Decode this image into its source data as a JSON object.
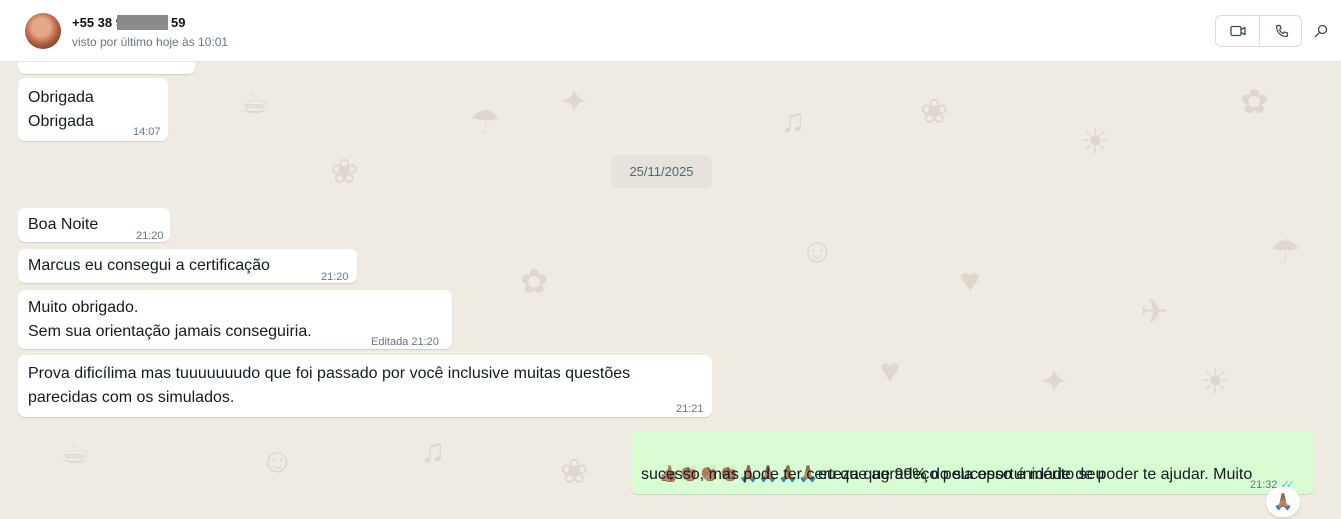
{
  "header": {
    "contact_name_prefix": "+55 38 9",
    "contact_name_suffix": "59",
    "last_seen": "visto por último hoje às 10:01",
    "icons": [
      "video-call-icon",
      "voice-call-icon",
      "search-icon"
    ]
  },
  "date_divider": "25/11/2025",
  "messages": [
    {
      "direction": "in",
      "lines": [
        "Obrigada",
        "Obrigada"
      ],
      "time": "14:07"
    },
    {
      "direction": "in",
      "lines": [
        "Boa Noite"
      ],
      "time": "21:20"
    },
    {
      "direction": "in",
      "lines": [
        "Marcus eu consegui a certificação"
      ],
      "time": "21:20"
    },
    {
      "direction": "in",
      "lines": [
        "Muito obrigado.",
        "Sem sua orientação jamais conseguiria."
      ],
      "edited_label": "Editada",
      "time": "21:20"
    },
    {
      "direction": "in",
      "lines": [
        "Prova dificílima mas tuuuuuuudo que foi passado por você inclusive muitas questões",
        "parecidas com os simulados."
      ],
      "time": "21:21"
    },
    {
      "direction": "out",
      "emoji_prefix": "👍🏽👏🏽👏🏽👏🏽🙏🏽🙏🏽🙏🏽🙏🏽",
      "lines": [
        "eu que agradeço pela oportunidade de poder te ajudar. Muito",
        "sucesso, mas pode ter certeza que 99% do sucesso é mérito seu"
      ],
      "time": "21:32",
      "status": "read",
      "reaction": "🙏🏽"
    }
  ],
  "colors": {
    "incoming_bubble": "#ffffff",
    "outgoing_bubble": "#d9fdd3",
    "chat_background": "#efeae2",
    "read_ticks": "#53bdeb"
  }
}
